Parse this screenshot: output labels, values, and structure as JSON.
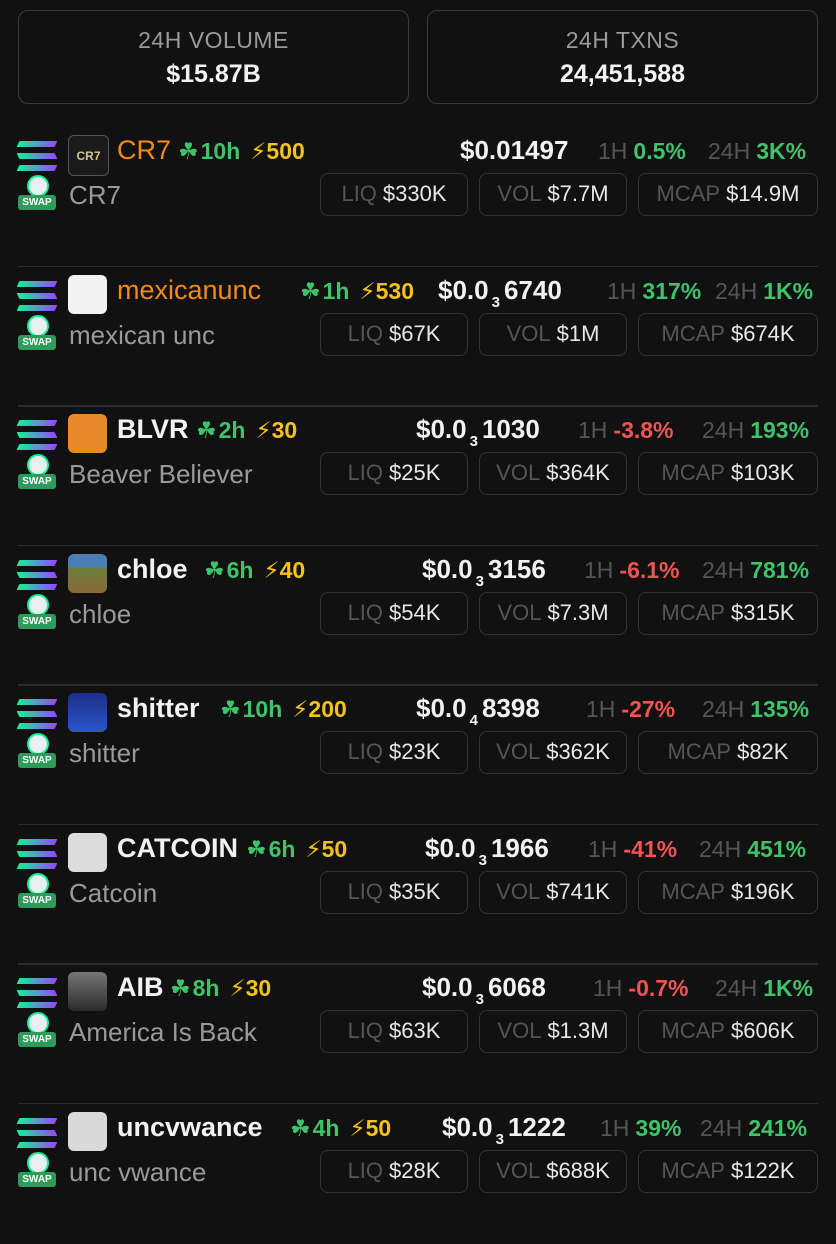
{
  "stats": {
    "volume_label": "24H VOLUME",
    "volume_value": "$15.87B",
    "txns_label": "24H TXNS",
    "txns_value": "24,451,588"
  },
  "labels": {
    "h1": "1H",
    "h24": "24H",
    "liq": "LIQ",
    "vol": "VOL",
    "mcap": "MCAP",
    "swap": "SWAP"
  },
  "colors": {
    "positive": "#3fc36a",
    "negative": "#f05454",
    "boost": "#f5c21b",
    "highlight_ticker": "#f08a1c"
  },
  "tokens": [
    {
      "ticker": "CR7",
      "name": "CR7",
      "age": "10h",
      "boost": "500",
      "price_main": "$0.01497",
      "price_zeros": "",
      "price_tail": "",
      "change_1h": "0.5%",
      "change_1h_dir": "pos",
      "change_24h": "3K%",
      "liq": "$330K",
      "vol": "$7.7M",
      "mcap": "$14.9M",
      "avatar_text": "CR7",
      "highlight": true
    },
    {
      "ticker": "mexicanunc",
      "name": "mexican unc",
      "age": "1h",
      "boost": "530",
      "price_main": "$0.0",
      "price_zeros": "3",
      "price_tail": "6740",
      "change_1h": "317%",
      "change_1h_dir": "pos",
      "change_24h": "1K%",
      "liq": "$67K",
      "vol": "$1M",
      "mcap": "$674K",
      "avatar_text": "",
      "highlight": true
    },
    {
      "ticker": "BLVR",
      "name": "Beaver Believer",
      "age": "2h",
      "boost": "30",
      "price_main": "$0.0",
      "price_zeros": "3",
      "price_tail": "1030",
      "change_1h": "-3.8%",
      "change_1h_dir": "neg",
      "change_24h": "193%",
      "liq": "$25K",
      "vol": "$364K",
      "mcap": "$103K",
      "avatar_text": "",
      "highlight": false
    },
    {
      "ticker": "chloe",
      "name": "chloe",
      "age": "6h",
      "boost": "40",
      "price_main": "$0.0",
      "price_zeros": "3",
      "price_tail": "3156",
      "change_1h": "-6.1%",
      "change_1h_dir": "neg",
      "change_24h": "781%",
      "liq": "$54K",
      "vol": "$7.3M",
      "mcap": "$315K",
      "avatar_text": "",
      "highlight": false
    },
    {
      "ticker": "shitter",
      "name": "shitter",
      "age": "10h",
      "boost": "200",
      "price_main": "$0.0",
      "price_zeros": "4",
      "price_tail": "8398",
      "change_1h": "-27%",
      "change_1h_dir": "neg",
      "change_24h": "135%",
      "liq": "$23K",
      "vol": "$362K",
      "mcap": "$82K",
      "avatar_text": "",
      "highlight": false
    },
    {
      "ticker": "CATCOIN",
      "name": "Catcoin",
      "age": "6h",
      "boost": "50",
      "price_main": "$0.0",
      "price_zeros": "3",
      "price_tail": "1966",
      "change_1h": "-41%",
      "change_1h_dir": "neg",
      "change_24h": "451%",
      "liq": "$35K",
      "vol": "$741K",
      "mcap": "$196K",
      "avatar_text": "",
      "highlight": false
    },
    {
      "ticker": "AIB",
      "name": "America Is Back",
      "age": "8h",
      "boost": "30",
      "price_main": "$0.0",
      "price_zeros": "3",
      "price_tail": "6068",
      "change_1h": "-0.7%",
      "change_1h_dir": "neg",
      "change_24h": "1K%",
      "liq": "$63K",
      "vol": "$1.3M",
      "mcap": "$606K",
      "avatar_text": "",
      "highlight": false
    },
    {
      "ticker": "uncvwance",
      "name": "unc vwance",
      "age": "4h",
      "boost": "50",
      "price_main": "$0.0",
      "price_zeros": "3",
      "price_tail": "1222",
      "change_1h": "39%",
      "change_1h_dir": "pos",
      "change_24h": "241%",
      "liq": "$28K",
      "vol": "$688K",
      "mcap": "$122K",
      "avatar_text": "",
      "highlight": false
    }
  ]
}
